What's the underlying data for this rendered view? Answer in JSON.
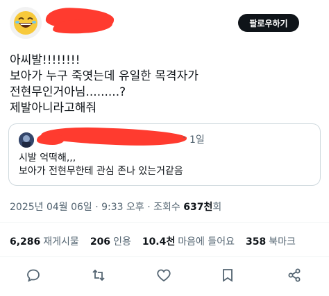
{
  "follow_label": "팔로우하기",
  "tweet_lines": [
    "아씨발!!!!!!!!",
    "보아가 누구 죽엿는데 유일한 목격자가",
    "전현무인거아님.........?",
    "제발아니라고해줘"
  ],
  "quote": {
    "time": "1일",
    "lines": [
      "시발 억떡해,,,",
      "보아가 전현무한테 관심 존나 있는거같음"
    ]
  },
  "meta": {
    "datetime": "2025년 04월 06일 · 9:33 오후",
    "dot": " · ",
    "views_label": "조회수",
    "views_value": "637천",
    "views_suffix": "회"
  },
  "stats": [
    {
      "value": "6,286",
      "label": "재게시물"
    },
    {
      "value": "206",
      "label": "인용"
    },
    {
      "value": "10.4천",
      "label": "마음에 들어요"
    },
    {
      "value": "358",
      "label": "북마크"
    }
  ],
  "icons": [
    "reply-icon",
    "repost-icon",
    "like-icon",
    "bookmark-icon",
    "share-icon"
  ]
}
